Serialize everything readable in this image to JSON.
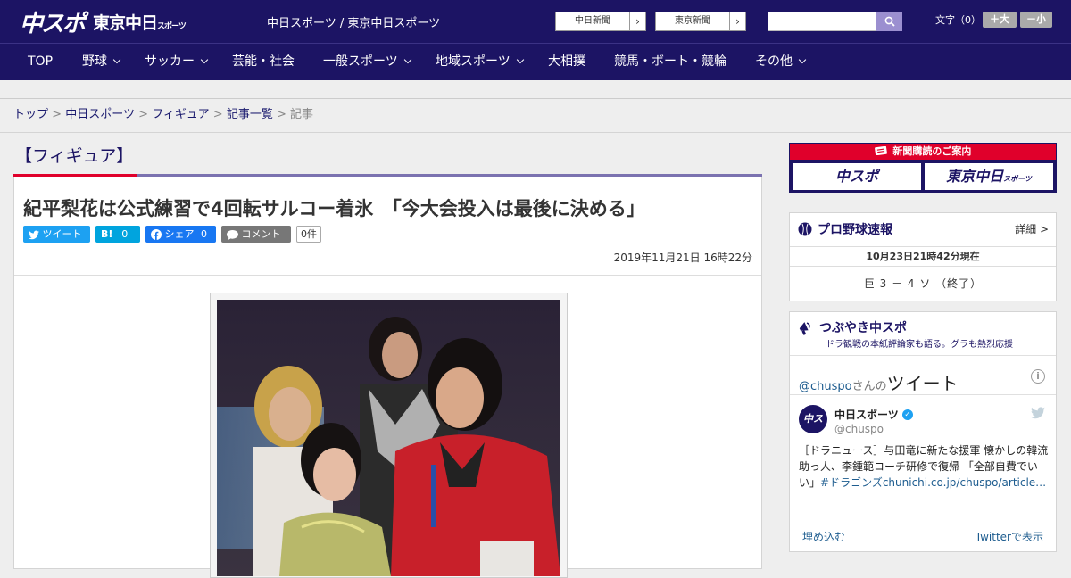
{
  "header": {
    "logo_chuspo": "中スポ",
    "logo_tokyo": "東京中日",
    "logo_tokyo_small": "スポーツ",
    "site_names": "中日スポーツ / 東京中日スポーツ",
    "ext_links": [
      {
        "label": "中日新聞",
        "arrow": "›"
      },
      {
        "label": "東京新聞",
        "arrow": "›"
      }
    ],
    "search_placeholder": "",
    "font_size_label": "文字（0）",
    "font_plus": "＋大",
    "font_minus": "－小"
  },
  "nav": {
    "items": [
      {
        "label": "TOP"
      },
      {
        "label": "野球"
      },
      {
        "label": "サッカー"
      },
      {
        "label": "芸能・社会"
      },
      {
        "label": "一般スポーツ"
      },
      {
        "label": "地域スポーツ"
      },
      {
        "label": "大相撲"
      },
      {
        "label": "競馬・ボート・競輪"
      },
      {
        "label": "その他"
      }
    ]
  },
  "breadcrumb": {
    "items": [
      "トップ",
      "中日スポーツ",
      "フィギュア",
      "記事一覧"
    ],
    "current": "記事",
    "sep": ">"
  },
  "section": {
    "title": "【フィギュア】"
  },
  "article": {
    "headline": "紀平梨花は公式練習で4回転サルコー着氷　「今大会投入は最後に決める」",
    "share": {
      "tweet": "ツイート",
      "hatena": "B!",
      "hatena_count": "0",
      "facebook": "シェア",
      "facebook_count": "0",
      "comment": "コメント",
      "comment_count": "0件"
    },
    "date": "2019年11月21日 16時22分"
  },
  "sidebar": {
    "subscribe": {
      "title": "新聞購読のご案内",
      "logo1": "中スポ",
      "logo2": "東京中日",
      "logo2_small": "スポーツ"
    },
    "pro_baseball": {
      "title": "プロ野球速報",
      "detail": "詳細 >",
      "time": "10月23日21時42分現在",
      "score": "巨 3 － 4 ソ （終了）"
    },
    "tsubuyaki": {
      "title": "つぶやき中スポ",
      "subtitle": "ドラ観戦の本紙評論家も語る。グラも熱烈応援",
      "handle": "@chuspo",
      "san": "さんの",
      "tweet_big": "ツイート",
      "info": "i",
      "tweet": {
        "avatar": "中スポ",
        "name": "中日スポーツ",
        "verified": "✓",
        "at": "@chuspo",
        "text": "［ドラニュース］与田竜に新たな援軍 懐かしの韓流助っ人、李鍾範コーチ研修で復帰 「全部自費でい",
        "text_cont": "い」",
        "link": "#ドラゴンズchunichi.co.jp/chuspo/article…"
      },
      "embed": "埋め込む",
      "view_on_twitter": "Twitterで表示"
    }
  }
}
